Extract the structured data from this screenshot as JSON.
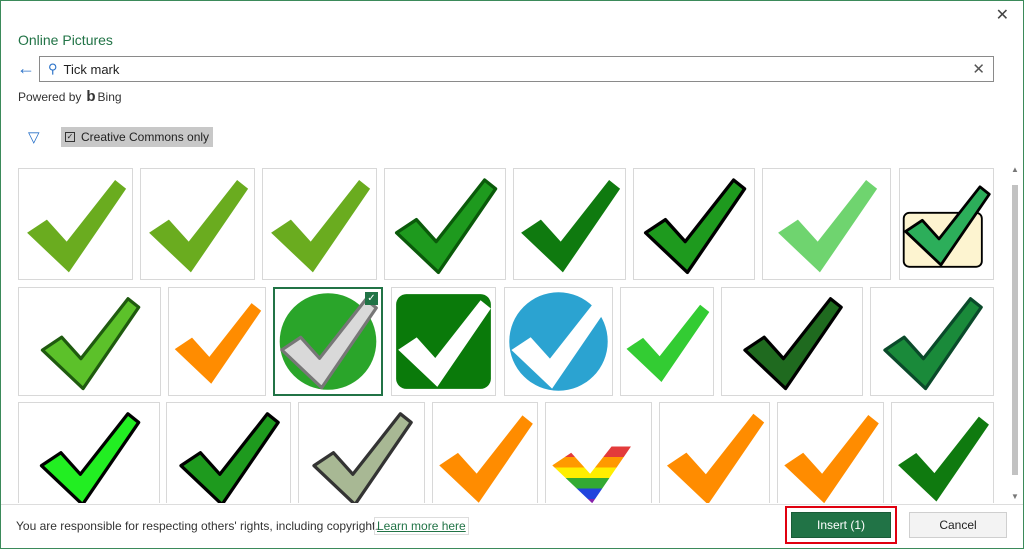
{
  "dialog": {
    "title": "Online Pictures"
  },
  "search": {
    "value": "Tick mark",
    "back_icon": "arrow-left-icon",
    "search_icon": "magnifier-icon",
    "clear_icon": "close-icon"
  },
  "powered": {
    "label": "Powered by",
    "brand": "Bing"
  },
  "filter": {
    "icon": "funnel-icon",
    "creative_commons_label": "Creative Commons only",
    "creative_commons_checked": true
  },
  "thumbnails": [
    {
      "fill": "#6aac1f",
      "stroke": "none",
      "bg": "none"
    },
    {
      "fill": "#6aac1f",
      "stroke": "none",
      "bg": "none"
    },
    {
      "fill": "#6aac1f",
      "stroke": "none",
      "bg": "none"
    },
    {
      "fill": "#1e9a1e",
      "stroke": "#0a5a0a",
      "bg": "none"
    },
    {
      "fill": "#0f7a0f",
      "stroke": "none",
      "bg": "none"
    },
    {
      "fill": "#1e9a1e",
      "stroke": "#000000",
      "bg": "none"
    },
    {
      "fill": "#6fd46f",
      "stroke": "none",
      "bg": "none"
    },
    {
      "fill": "#2cae5a",
      "stroke": "#000000",
      "bg": "#fdf4d0"
    },
    {
      "fill": "#5cc12a",
      "stroke": "#1f5a0f",
      "bg": "none"
    },
    {
      "fill": "#ff8c00",
      "stroke": "none",
      "bg": "none"
    },
    {
      "fill": "#d9d9d9",
      "stroke": "#777777",
      "bg": "circle:#2aa52a",
      "selected": true
    },
    {
      "fill": "#ffffff",
      "stroke": "none",
      "bg": "rounded:#0a7a0a"
    },
    {
      "fill": "#ffffff",
      "stroke": "none",
      "bg": "circle:#2ba3d1"
    },
    {
      "fill": "#33cc33",
      "stroke": "none",
      "bg": "none"
    },
    {
      "fill": "#1f6a1f",
      "stroke": "#000000",
      "bg": "none"
    },
    {
      "fill": "#1a8a3a",
      "stroke": "#0a4a2a",
      "bg": "none"
    },
    {
      "fill": "#22ee22",
      "stroke": "#000000",
      "bg": "none"
    },
    {
      "fill": "#1e9a1e",
      "stroke": "#000000",
      "bg": "none"
    },
    {
      "fill": "#a8b894",
      "stroke": "#333333",
      "bg": "none"
    },
    {
      "fill": "#ff8c00",
      "stroke": "none",
      "bg": "none"
    },
    {
      "fill": "#e33b3b",
      "stroke": "none",
      "bg": "none",
      "rainbow": true
    },
    {
      "fill": "#ff8c00",
      "stroke": "none",
      "bg": "none"
    },
    {
      "fill": "#ff8c00",
      "stroke": "none",
      "bg": "none"
    },
    {
      "fill": "#0f7a0f",
      "stroke": "none",
      "bg": "none"
    }
  ],
  "selected_check": "✓",
  "footer": {
    "notice": "You are responsible for respecting others' rights, including copyright.",
    "learn_more": "Learn more here",
    "insert_label": "Insert (1)",
    "cancel_label": "Cancel"
  }
}
